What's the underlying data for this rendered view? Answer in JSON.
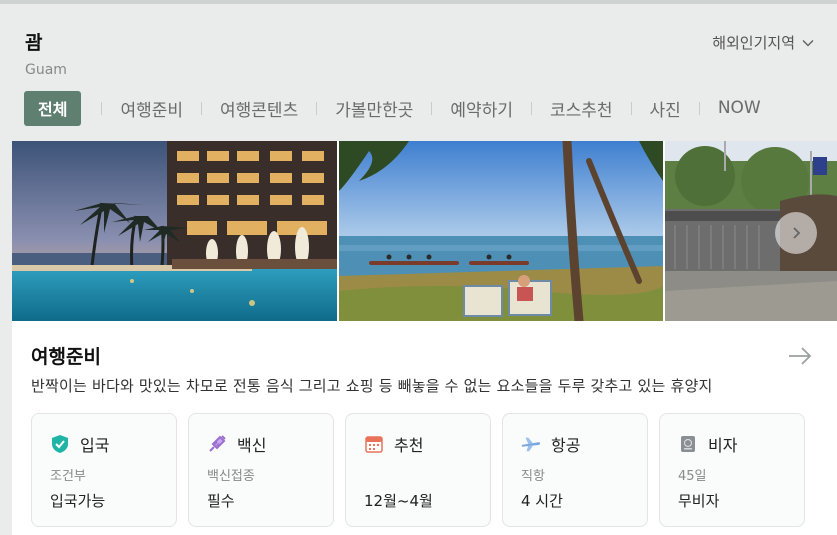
{
  "header": {
    "title": "괌",
    "subtitle": "Guam",
    "region_label": "해외인기지역"
  },
  "tabs": [
    {
      "label": "전체",
      "active": true
    },
    {
      "label": "여행준비"
    },
    {
      "label": "여행콘텐츠"
    },
    {
      "label": "가볼만한곳"
    },
    {
      "label": "예약하기"
    },
    {
      "label": "코스추천"
    },
    {
      "label": "사진"
    },
    {
      "label": "NOW"
    }
  ],
  "gallery": {
    "images": [
      "resort-pool-at-dusk",
      "beach-with-canoe-and-palm-trees",
      "pacific-war-museum-building"
    ]
  },
  "section": {
    "title": "여행준비",
    "description": "반짝이는 바다와 맛있는 차모로 전통 음식 그리고 쇼핑 등 빼놓을 수 없는 요소들을 두루 갖추고 있는 휴양지"
  },
  "info_cards": [
    {
      "icon": "shield-check-icon",
      "label": "입국",
      "sub": "조건부",
      "value": "입국가능"
    },
    {
      "icon": "syringe-icon",
      "label": "백신",
      "sub": "백신접종",
      "value": "필수"
    },
    {
      "icon": "calendar-icon",
      "label": "추천",
      "sub": "",
      "value": "12월~4월"
    },
    {
      "icon": "airplane-icon",
      "label": "항공",
      "sub": "직항",
      "value": "4 시간"
    },
    {
      "icon": "passport-icon",
      "label": "비자",
      "sub": "45일",
      "value": "무비자"
    }
  ],
  "colors": {
    "accent": "#5f7f71",
    "background": "#e9eceb",
    "shield": "#1fb5a6",
    "syringe": "#9b6fcf",
    "calendar": "#e8735a",
    "airplane": "#7aa7e0",
    "passport": "#8a8f94"
  }
}
